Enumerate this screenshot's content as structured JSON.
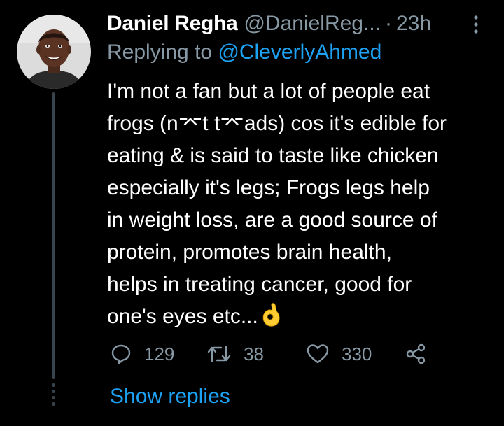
{
  "tweet": {
    "author": {
      "display_name": "Daniel Regha",
      "handle": "@DanielReg...",
      "avatar_icon": "profile-photo"
    },
    "separator": "·",
    "timestamp": "23h",
    "more_icon": "vertical-ellipsis-icon",
    "replying_to": {
      "prefix": "Replying to",
      "handle": "@CleverlyAhmed"
    },
    "body_lines": [
      "I'm not a fan but a lot of people eat",
      "frogs (n⌤t t⌤ads) cos it's edible for",
      "eating & is said to taste like chicken",
      "especially it's legs; Frogs legs help",
      "in weight loss, are a good source of",
      "protein, promotes brain health,",
      "helps in treating cancer, good for",
      "one's eyes etc..."
    ],
    "trailing_emoji": "ok-hand-emoji",
    "actions": {
      "reply": {
        "icon": "reply-icon",
        "count": "129"
      },
      "retweet": {
        "icon": "retweet-icon",
        "count": "38"
      },
      "like": {
        "icon": "heart-icon",
        "count": "330"
      },
      "share": {
        "icon": "share-icon"
      }
    },
    "show_replies_label": "Show replies"
  },
  "colors": {
    "background": "#000000",
    "primary_text": "#ffffff",
    "secondary_text": "#8899a6",
    "link": "#1da1f2",
    "thread_line": "#38444d"
  }
}
